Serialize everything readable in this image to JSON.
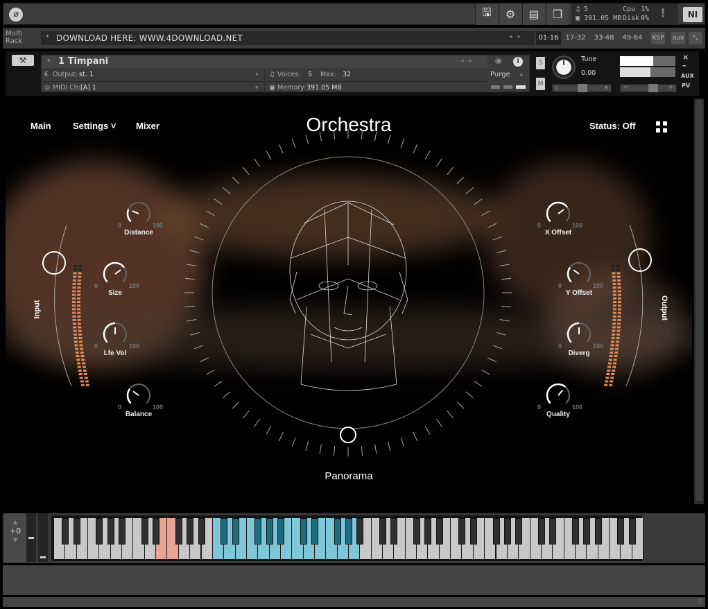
{
  "topbar": {
    "logo_icon": "kontakt-logo-icon",
    "buttons": [
      {
        "name": "save",
        "icon": "floppy-disk-icon"
      },
      {
        "name": "options",
        "icon": "gear-icon"
      },
      {
        "name": "view",
        "icon": "layout-icon"
      },
      {
        "name": "minimize-view",
        "icon": "window-restore-icon"
      }
    ],
    "stats": {
      "voices": "5",
      "memory": "391.05 MB",
      "cpu_label": "Cpu",
      "cpu_value": "1%",
      "disk_label": "Disk",
      "disk_value": "0%"
    },
    "warning": "!",
    "ni_logo": "NI"
  },
  "rack": {
    "label_line1": "Multi",
    "label_line2": "Rack",
    "preset_name": "DOWNLOAD HERE: WWW.4DOWNLOAD.NET",
    "page_tabs": [
      "01-16",
      "17-32",
      "33-48",
      "49-64"
    ],
    "active_tab": "01-16",
    "ksp_label": "KSP",
    "aux_label": "aux"
  },
  "instrument": {
    "name": "1 Timpani",
    "output_label": "Output:",
    "output_value": "st. 1",
    "midi_label": "MIDI Ch:",
    "midi_value": "[A]  1",
    "voices_label": "Voices:",
    "voices_value": "5",
    "max_label": "Max:",
    "max_value": "32",
    "memory_label": "Memory:",
    "memory_value": "391.05 MB",
    "purge_label": "Purge",
    "solo_label": "S",
    "mute_label": "M",
    "tune_label": "Tune",
    "tune_value": "0.00",
    "pan_left": "L",
    "pan_right": "R",
    "vol_minus": "−",
    "vol_plus": "+",
    "close": "×",
    "minimize": "–",
    "aux": "AUX",
    "pv": "PV"
  },
  "panel": {
    "nav": {
      "main": "Main",
      "settings": "Settings ˅",
      "mixer": "Mixer"
    },
    "title": "Orchestra",
    "status": "Status:  Off",
    "input_label": "Input",
    "output_label": "Output",
    "panorama_label": "Panorama",
    "panorama_value": 0.5,
    "input_level": 0.6,
    "output_level": 0.6,
    "knobs_left": [
      {
        "label": "Distance",
        "min": "0",
        "max": "100",
        "value": 25
      },
      {
        "label": "Size",
        "min": "0",
        "max": "100",
        "value": 70
      },
      {
        "label": "Lfe Vol",
        "min": "0",
        "max": "100",
        "value": 50
      },
      {
        "label": "Balance",
        "min": "0",
        "max": "100",
        "value": 30
      }
    ],
    "knobs_right": [
      {
        "label": "X Offset",
        "min": "0",
        "max": "100",
        "value": 70
      },
      {
        "label": "Y Offset",
        "min": "0",
        "max": "100",
        "value": 30
      },
      {
        "label": "Diverg",
        "min": "0",
        "max": "100",
        "value": 50
      },
      {
        "label": "Quality",
        "min": "0",
        "max": "100",
        "value": 65
      }
    ]
  },
  "keyboard": {
    "octave_shift": "+0",
    "white_keys": 52,
    "highlight_red_white": [
      9,
      10
    ],
    "highlight_blue_range": [
      14,
      22
    ],
    "colors": {
      "red": "#e8a392",
      "blue": "#7ec6d8",
      "blue_black": "#1f6b80",
      "red_black": "#7a3a24"
    }
  }
}
